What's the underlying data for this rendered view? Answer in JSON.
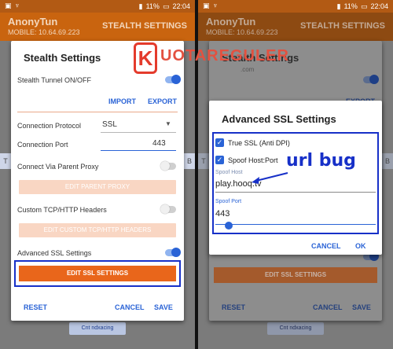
{
  "status": {
    "percent": "11%",
    "time": "22:04"
  },
  "app": {
    "title": "AnonyTun",
    "subtitle": "MOBILE: 10.64.69.223",
    "tab": "STEALTH SETTINGS"
  },
  "edge_labels": {
    "left": "T",
    "right": "B"
  },
  "bg_button": "Cnt ndxacing",
  "stealth": {
    "title": "Stealth Settings",
    "tunnel_label": "Stealth Tunnel ON/OFF",
    "import": "IMPORT",
    "export": "EXPORT",
    "protocol_label": "Connection Protocol",
    "protocol_value": "SSL",
    "port_label": "Connection Port",
    "port_value": "443",
    "parent_proxy_label": "Connect Via Parent Proxy",
    "edit_parent_proxy": "EDIT PARENT PROXY",
    "custom_headers_label": "Custom TCP/HTTP Headers",
    "edit_custom_headers": "EDIT CUSTOM TCP/HTTP HEADERS",
    "advanced_ssl_label": "Advanced SSL Settings",
    "edit_ssl": "EDIT SSL SETTINGS",
    "reset": "RESET",
    "cancel": "CANCEL",
    "save": "SAVE"
  },
  "ssl": {
    "title": "Advanced SSL Settings",
    "true_ssl": "True SSL (Anti DPI)",
    "spoof_hostport": "Spoof Host:Port",
    "spoof_host_label": "Spoof Host",
    "spoof_host_value": "play.hooq.tv",
    "spoof_port_label": "Spoof Port",
    "spoof_port_value": "443",
    "cancel": "CANCEL",
    "ok": "OK"
  },
  "annotation": "url bug",
  "logo": {
    "letter": "K",
    "word": "UOTAREGULER",
    "domain": ".com"
  }
}
